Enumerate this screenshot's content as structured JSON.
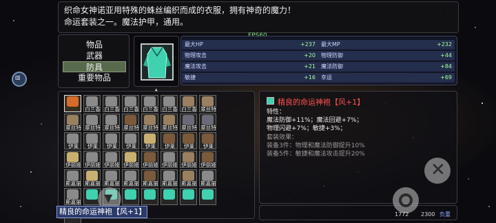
{
  "description": {
    "line1": "织命女神诺亚用特殊的蛛丝编织而成的衣服，拥有神奇的魔力！",
    "line2": "命运套装之一。魔法护甲，通用。"
  },
  "fps": "FPS60",
  "categories": [
    {
      "label": "物品",
      "active": false
    },
    {
      "label": "武器",
      "active": false
    },
    {
      "label": "防具",
      "active": true
    },
    {
      "label": "重要物品",
      "active": false
    }
  ],
  "stats": [
    {
      "name": "最大HP",
      "value": "+237"
    },
    {
      "name": "最大MP",
      "value": "+232"
    },
    {
      "name": "物理攻击",
      "value": "+20"
    },
    {
      "name": "物理防御",
      "value": "+44"
    },
    {
      "name": "魔法攻击",
      "value": "+21"
    },
    {
      "name": "魔法防御",
      "value": "+84"
    },
    {
      "name": "敏捷",
      "value": "+16"
    },
    {
      "name": "幸运",
      "value": "+69"
    }
  ],
  "inventory": [
    {
      "label": "",
      "icon": "selected-armor-icon",
      "selected": true
    },
    {
      "label": "白兰香",
      "icon": "armor-icon"
    },
    {
      "label": "白兰香",
      "icon": "armor-icon"
    },
    {
      "label": "白兰香",
      "icon": "armor-icon"
    },
    {
      "label": "白兰香",
      "icon": "armor-icon"
    },
    {
      "label": "白兰香",
      "icon": "armor-icon"
    },
    {
      "label": "白兰香",
      "icon": "helmet-icon"
    },
    {
      "label": "翠丝特",
      "icon": "helmet-icon"
    },
    {
      "label": "翠丝特",
      "icon": "helmet-icon"
    },
    {
      "label": "翠丝特",
      "icon": "armor-icon"
    },
    {
      "label": "翠丝特",
      "icon": "armor-icon"
    },
    {
      "label": "翠丝特",
      "icon": "boots-icon"
    },
    {
      "label": "翠丝特",
      "icon": "helmet-icon"
    },
    {
      "label": "翠丝特",
      "icon": "helmet-icon"
    },
    {
      "label": "翠丝特",
      "icon": "gloves-icon"
    },
    {
      "label": "翠丝特",
      "icon": "gloves-icon"
    },
    {
      "label": "伊莱",
      "icon": "armor-icon"
    },
    {
      "label": "伊莱",
      "icon": "armor-icon"
    },
    {
      "label": "伊莱",
      "icon": "armor-icon"
    },
    {
      "label": "伊莱",
      "icon": "armor-icon"
    },
    {
      "label": "伊莱",
      "icon": "ring-icon"
    },
    {
      "label": "伊莱",
      "icon": "boots-icon"
    },
    {
      "label": "伊莱",
      "icon": "boots-icon"
    },
    {
      "label": "伊莱",
      "icon": "boots-icon"
    },
    {
      "label": "伊丽娅",
      "icon": "ring-icon"
    },
    {
      "label": "伊丽娅",
      "icon": "armor-icon"
    },
    {
      "label": "伊丽娅",
      "icon": "armor-icon"
    },
    {
      "label": "伊丽娅",
      "icon": "ring-icon"
    },
    {
      "label": "伊丽娅",
      "icon": "boots-icon"
    },
    {
      "label": "伊丽娅",
      "icon": "armor-icon"
    },
    {
      "label": "伊丽娅",
      "icon": "helmet-icon"
    },
    {
      "label": "伊丽娅",
      "icon": "boots-icon"
    },
    {
      "label": "斯嘉丽",
      "icon": "armor-icon"
    },
    {
      "label": "斯嘉丽",
      "icon": "ring-icon"
    },
    {
      "label": "斯嘉丽",
      "icon": "armor-icon"
    },
    {
      "label": "斯嘉丽",
      "icon": "armor-icon"
    },
    {
      "label": "斯嘉丽",
      "icon": "boots-icon"
    },
    {
      "label": "斯嘉丽",
      "icon": "armor-icon"
    },
    {
      "label": "斯嘉丽",
      "icon": "helmet-icon"
    },
    {
      "label": "斯嘉丽",
      "icon": "armor-icon"
    },
    {
      "label": "斯嘉丽",
      "icon": "armor-icon"
    },
    {
      "label": "",
      "icon": "robe-icon"
    },
    {
      "label": "",
      "icon": "robe-icon"
    },
    {
      "label": "",
      "icon": "robe-icon"
    },
    {
      "label": "",
      "icon": "robe-icon"
    },
    {
      "label": "",
      "icon": "robe-icon"
    },
    {
      "label": "",
      "icon": "robe-icon"
    },
    {
      "label": "",
      "icon": "robe-icon"
    },
    {
      "label": "",
      "icon": "robe-icon"
    }
  ],
  "selected_item_name": "精良的命运神袍【风+1】",
  "detail": {
    "title": "精良的命运神袍【风+1】",
    "traits_header": "特性：",
    "trait1": "魔法防御+11%；魔法回避+7%；",
    "trait2": "物理闪避+7%；敏捷+3%；",
    "set_header": "套装效果：",
    "set1": "装备3件：物理和魔法防御提升10%",
    "set2": "装备5件：敏捷和魔法攻击提升20%"
  },
  "bottom": {
    "count_a": "1772",
    "count_b": "2300",
    "weight_label": "负重"
  },
  "colors": {
    "accent": "#586a4c",
    "stat_value": "#a8ff9c",
    "item_title": "#ff5050",
    "robe": "#3fd1b0"
  }
}
